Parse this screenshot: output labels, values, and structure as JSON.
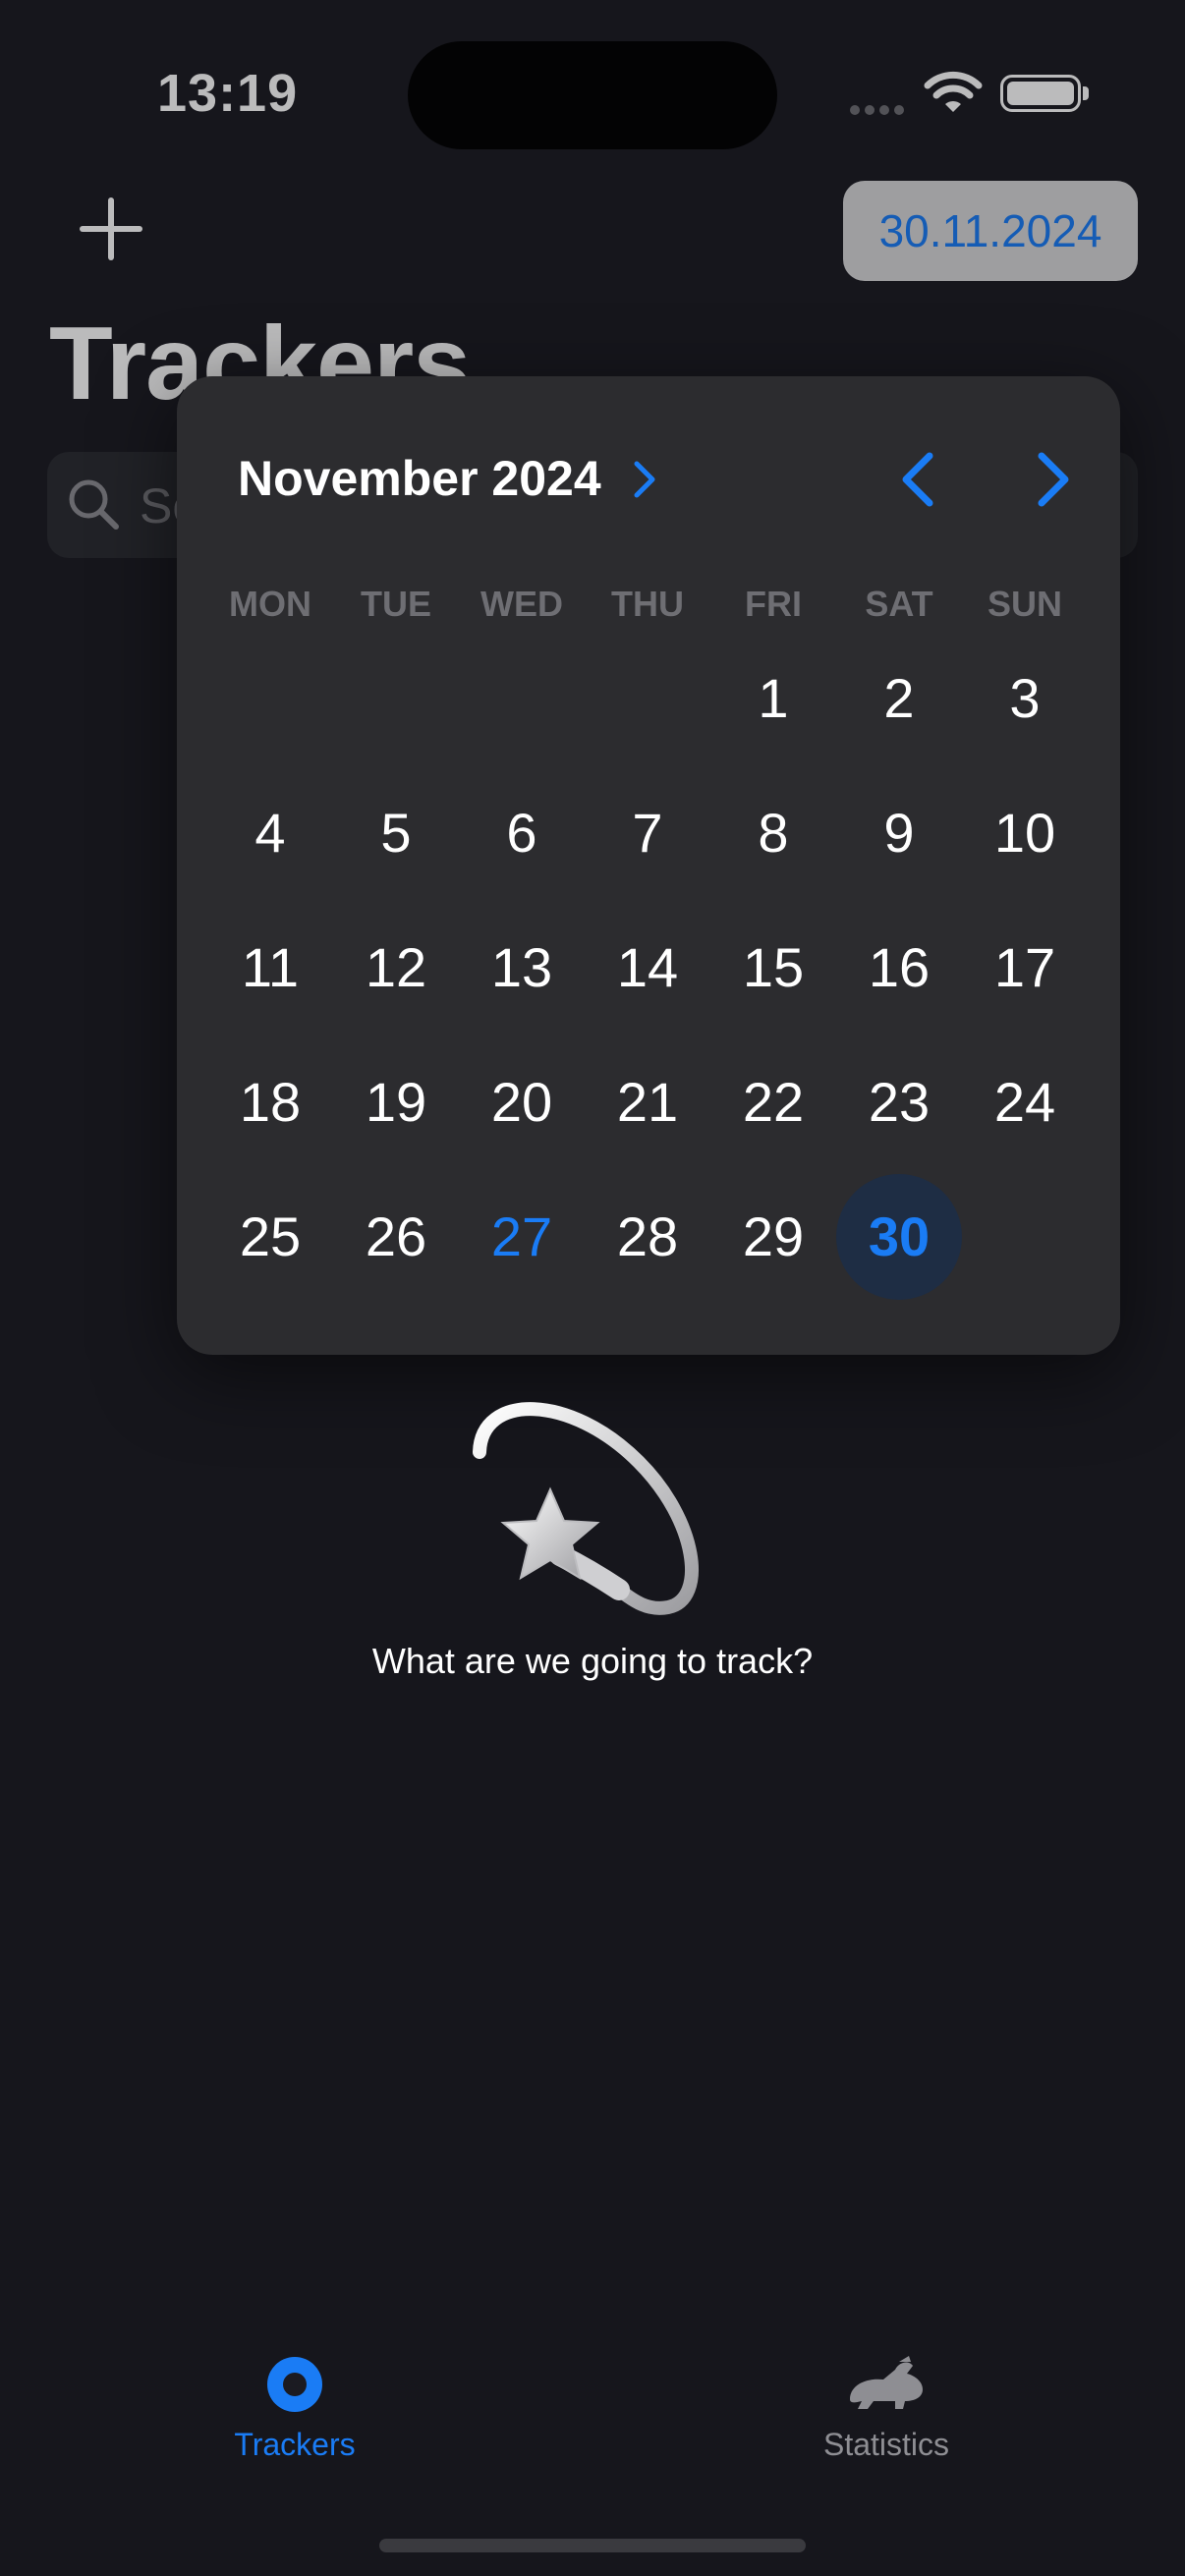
{
  "status_bar": {
    "time": "13:19"
  },
  "header": {
    "add_icon": "plus-icon",
    "date_label": "30.11.2024",
    "title": "Trackers"
  },
  "search": {
    "placeholder": "Search",
    "icon": "search-icon"
  },
  "calendar": {
    "month_label": "November 2024",
    "weekdays": [
      "MON",
      "TUE",
      "WED",
      "THU",
      "FRI",
      "SAT",
      "SUN"
    ],
    "first_weekday_index": 4,
    "days": [
      "1",
      "2",
      "3",
      "4",
      "5",
      "6",
      "7",
      "8",
      "9",
      "10",
      "11",
      "12",
      "13",
      "14",
      "15",
      "16",
      "17",
      "18",
      "19",
      "20",
      "21",
      "22",
      "23",
      "24",
      "25",
      "26",
      "27",
      "28",
      "29",
      "30"
    ],
    "today": "27",
    "selected": "30",
    "accent": "#1a7cf5"
  },
  "empty_state": {
    "icon": "shooting-star-icon",
    "message": "What are we going to track?"
  },
  "tab_bar": {
    "items": [
      {
        "label": "Trackers",
        "icon": "record-circle-icon",
        "active": true
      },
      {
        "label": "Statistics",
        "icon": "hare-icon",
        "active": false
      }
    ]
  },
  "colors": {
    "background": "#1b1b22",
    "popup": "#2c2c2f",
    "accent": "#1a7cf5",
    "selected_day_bg": "#1e2d44"
  }
}
